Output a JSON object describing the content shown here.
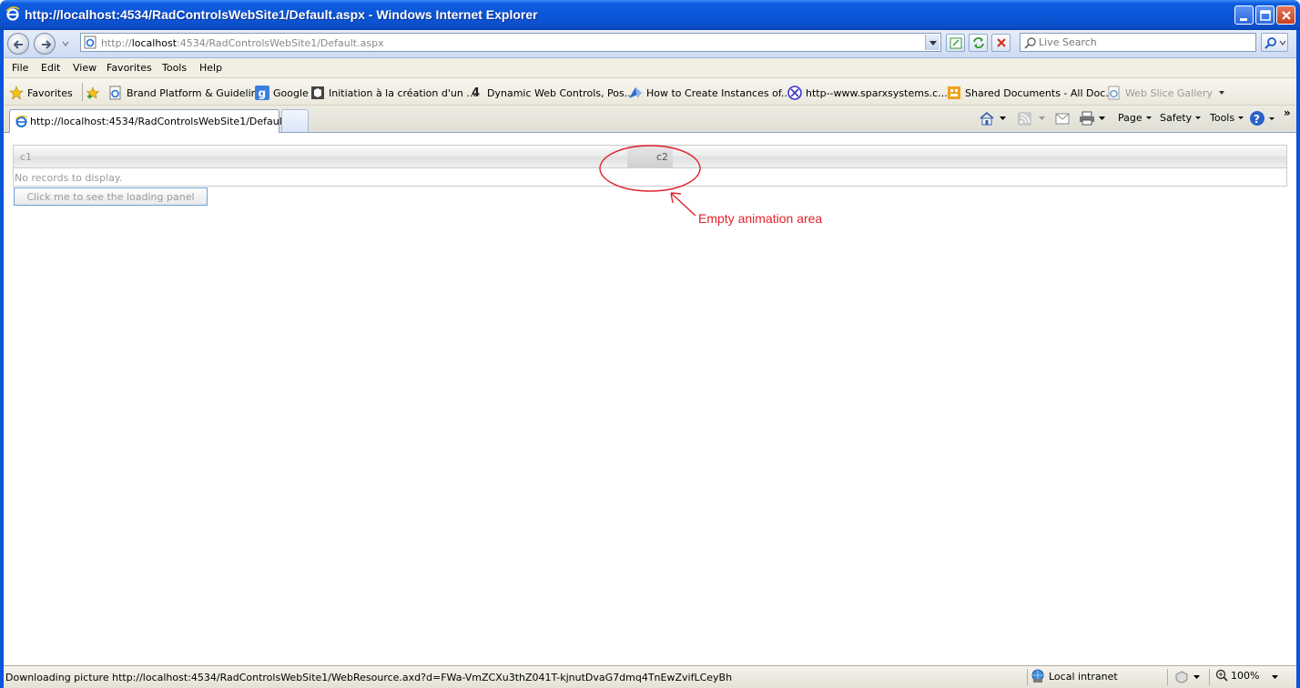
{
  "window": {
    "title": "http://localhost:4534/RadControlsWebSite1/Default.aspx - Windows Internet Explorer"
  },
  "address": {
    "url_prefix": "http://",
    "url_host": "localhost",
    "url_rest": ":4534/RadControlsWebSite1/Default.aspx"
  },
  "search": {
    "placeholder": "Live Search"
  },
  "menu": {
    "file": "File",
    "edit": "Edit",
    "view": "View",
    "favorites": "Favorites",
    "tools": "Tools",
    "help": "Help"
  },
  "favorites_bar": {
    "favorites_label": "Favorites",
    "items": [
      "Brand Platform & Guidelines",
      "Google",
      "Initiation à la création d'un ...",
      "Dynamic Web Controls, Pos...",
      "How to Create Instances of...",
      "http--www.sparxsystems.c...",
      "Shared Documents - All Doc...",
      "Web Slice Gallery"
    ]
  },
  "tabs": {
    "active_label": "http://localhost:4534/RadControlsWebSite1/Default...."
  },
  "commands": {
    "page": "Page",
    "safety": "Safety",
    "tools": "Tools",
    "more": "»"
  },
  "grid": {
    "col1": "c1",
    "col2": "c2",
    "no_records": "No records to display."
  },
  "page": {
    "button_label": "Click me to see the loading panel",
    "annotation": "Empty animation area",
    "annotation_color": "#e0222c"
  },
  "status": {
    "message": "Downloading picture http://localhost:4534/RadControlsWebSite1/WebResource.axd?d=FWa-VmZCXu3thZ041T-kjnutDvaG7dmq4TnEwZvifLCeyBh",
    "zone": "Local intranet",
    "zoom": "100%"
  }
}
